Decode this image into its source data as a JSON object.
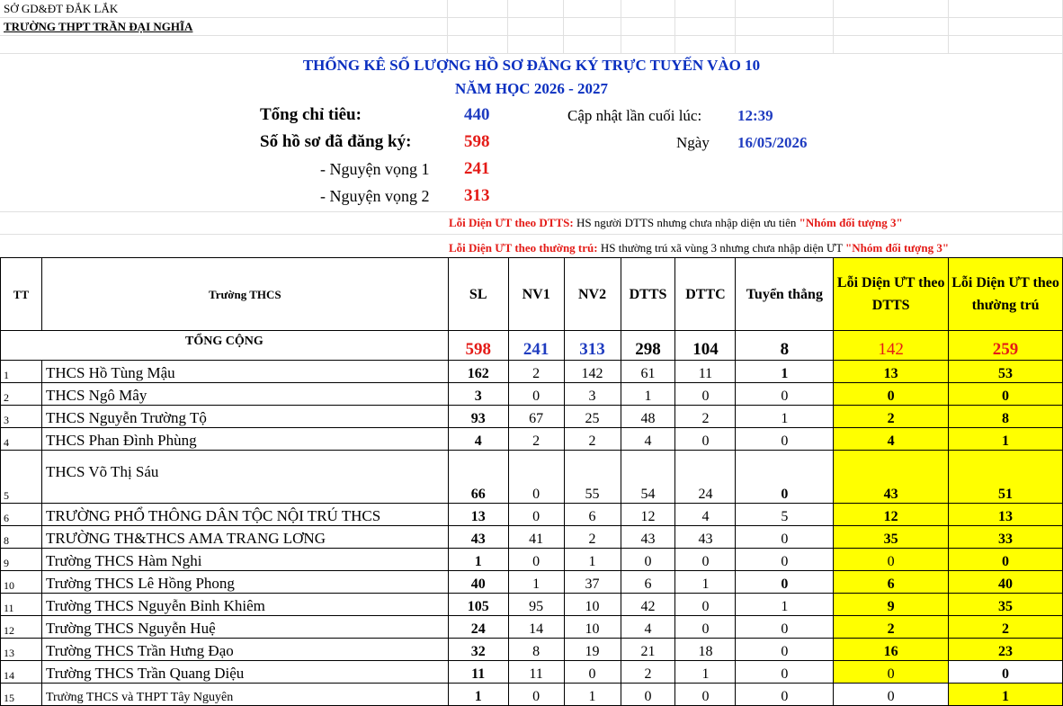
{
  "header": {
    "dept": "SỞ GD&ĐT ĐẮK LẮK",
    "school": "TRƯỜNG THPT TRẦN ĐẠI NGHĨA"
  },
  "title": {
    "line1": "THỐNG KÊ SỐ LƯỢNG HỒ SƠ ĐĂNG KÝ TRỰC TUYẾN VÀO 10",
    "line2": "NĂM HỌC 2026 - 2027"
  },
  "summary": {
    "quota_label": "Tổng chỉ tiêu:",
    "quota_value": "440",
    "registered_label": "Số hồ sơ đã đăng ký:",
    "registered_value": "598",
    "nv1_label": "- Nguyện vọng 1",
    "nv1_value": "241",
    "nv2_label": "- Nguyện vọng 2",
    "nv2_value": "313",
    "updated_label": "Cập nhật lần cuối lúc:",
    "updated_time": "12:39",
    "date_label": "Ngày",
    "date_value": "16/05/2026"
  },
  "notes": {
    "n1_title": "Lỗi Diện ƯT theo DTTS:",
    "n1_text": " HS người DTTS nhưng chưa nhập diện ưu tiên ",
    "n1_quote": "\"Nhóm đối tượng 3\"",
    "n2_title": "Lỗi Diện ƯT theo thường trú:",
    "n2_text": " HS thường trú xã vùng 3 nhưng chưa nhập diện ƯT ",
    "n2_quote": "\"Nhóm đối tượng 3\""
  },
  "table": {
    "headers": {
      "tt": "TT",
      "school": "Trường THCS",
      "sl": "SL",
      "nv1": "NV1",
      "nv2": "NV2",
      "dtts": "DTTS",
      "dttc": "DTTC",
      "direct": "Tuyển thẳng",
      "err_dtts": "Lỗi Diện ƯT theo DTTS",
      "err_resident": "Lỗi Diện ƯT theo thường trú"
    },
    "total": {
      "label": "TỔNG CỘNG",
      "sl": "598",
      "nv1": "241",
      "nv2": "313",
      "dtts": "298",
      "dttc": "104",
      "direct": "8",
      "err_dtts": "142",
      "err_resident": "259"
    },
    "rows": [
      {
        "tt": "1",
        "name": "THCS Hồ Tùng Mậu",
        "sl": "162",
        "nv1": "2",
        "nv2": "142",
        "dtts": "61",
        "dttc": "11",
        "direct": "1",
        "err_dtts": "13",
        "err_res": "53"
      },
      {
        "tt": "2",
        "name": "THCS Ngô Mây",
        "sl": "3",
        "nv1": "0",
        "nv2": "3",
        "dtts": "1",
        "dttc": "0",
        "direct": "0",
        "err_dtts": "0",
        "err_res": "0"
      },
      {
        "tt": "3",
        "name": "THCS Nguyễn Trường Tộ",
        "sl": "93",
        "nv1": "67",
        "nv2": "25",
        "dtts": "48",
        "dttc": "2",
        "direct": "1",
        "err_dtts": "2",
        "err_res": "8"
      },
      {
        "tt": "4",
        "name": "THCS Phan Đình Phùng",
        "sl": "4",
        "nv1": "2",
        "nv2": "2",
        "dtts": "4",
        "dttc": "0",
        "direct": "0",
        "err_dtts": "4",
        "err_res": "1"
      },
      {
        "tt": "5",
        "name": "THCS Võ Thị Sáu",
        "sl": "66",
        "nv1": "0",
        "nv2": "55",
        "dtts": "54",
        "dttc": "24",
        "direct": "0",
        "err_dtts": "43",
        "err_res": "51"
      },
      {
        "tt": "6",
        "name": "TRƯỜNG PHỔ THÔNG DÂN TỘC NỘI TRÚ THCS",
        "sl": "13",
        "nv1": "0",
        "nv2": "6",
        "dtts": "12",
        "dttc": "4",
        "direct": "5",
        "err_dtts": "12",
        "err_res": "13"
      },
      {
        "tt": "8",
        "name": "TRƯỜNG TH&THCS AMA TRANG LƠNG",
        "sl": "43",
        "nv1": "41",
        "nv2": "2",
        "dtts": "43",
        "dttc": "43",
        "direct": "0",
        "err_dtts": "35",
        "err_res": "33"
      },
      {
        "tt": "9",
        "name": "Trường THCS Hàm Nghi",
        "sl": "1",
        "nv1": "0",
        "nv2": "1",
        "dtts": "0",
        "dttc": "0",
        "direct": "0",
        "err_dtts": "0",
        "err_res": "0"
      },
      {
        "tt": "10",
        "name": "Trường THCS Lê Hồng Phong",
        "sl": "40",
        "nv1": "1",
        "nv2": "37",
        "dtts": "6",
        "dttc": "1",
        "direct": "0",
        "err_dtts": "6",
        "err_res": "40"
      },
      {
        "tt": "11",
        "name": "Trường THCS Nguyễn Bỉnh Khiêm",
        "sl": "105",
        "nv1": "95",
        "nv2": "10",
        "dtts": "42",
        "dttc": "0",
        "direct": "1",
        "err_dtts": "9",
        "err_res": "35"
      },
      {
        "tt": "12",
        "name": "Trường THCS Nguyễn Huệ",
        "sl": "24",
        "nv1": "14",
        "nv2": "10",
        "dtts": "4",
        "dttc": "0",
        "direct": "0",
        "err_dtts": "2",
        "err_res": "2"
      },
      {
        "tt": "13",
        "name": "Trường THCS Trần Hưng Đạo",
        "sl": "32",
        "nv1": "8",
        "nv2": "19",
        "dtts": "21",
        "dttc": "18",
        "direct": "0",
        "err_dtts": "16",
        "err_res": "23"
      },
      {
        "tt": "14",
        "name": "Trường THCS Trần Quang Diệu",
        "sl": "11",
        "nv1": "11",
        "nv2": "0",
        "dtts": "2",
        "dttc": "1",
        "direct": "0",
        "err_dtts": "0",
        "err_res": "0"
      },
      {
        "tt": "15",
        "name": "Trường THCS và THPT Tây Nguyên",
        "sl": "1",
        "nv1": "0",
        "nv2": "1",
        "dtts": "0",
        "dttc": "0",
        "direct": "0",
        "err_dtts": "0",
        "err_res": "1"
      }
    ]
  }
}
